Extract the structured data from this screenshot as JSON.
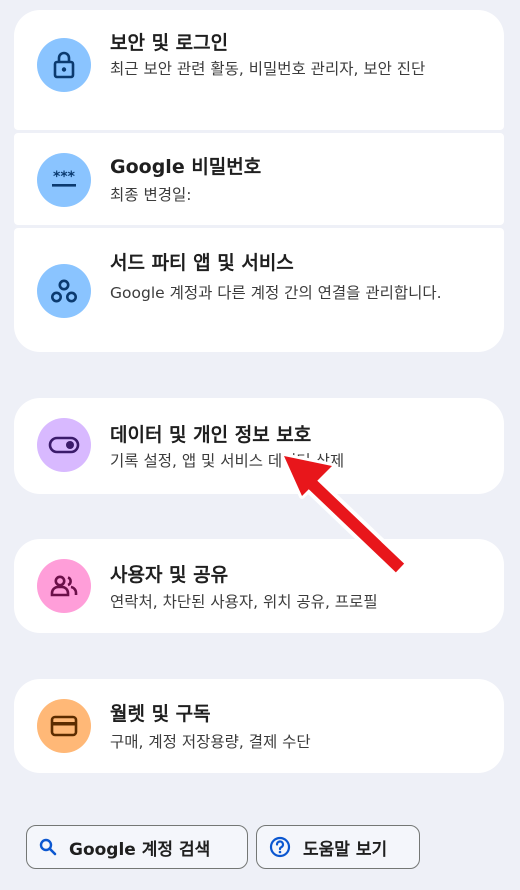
{
  "items": [
    {
      "title": "보안 및 로그인",
      "desc": "최근 보안 관련 활동, 비밀번호 관리자, 보안 진단",
      "icon": "lock-icon"
    },
    {
      "title": "Google 비밀번호",
      "desc": "최종 변경일:",
      "icon": "password-icon"
    },
    {
      "title": "서드 파티 앱 및 서비스",
      "desc": "Google 계정과 다른 계정 간의 연결을 관리합니다.",
      "icon": "connected-apps-icon"
    },
    {
      "title": "데이터 및 개인 정보 보호",
      "desc": "기록 설정, 앱 및 서비스 데이터 삭제",
      "icon": "toggle-icon"
    },
    {
      "title": "사용자 및 공유",
      "desc": "연락처, 차단된 사용자, 위치 공유, 프로필",
      "icon": "people-icon"
    },
    {
      "title": "월렛 및 구독",
      "desc": "구매, 계정 저장용량, 결제 수단",
      "icon": "wallet-icon"
    }
  ],
  "footer": {
    "search_label": "Google 계정 검색",
    "help_label": "도움말 보기"
  },
  "colors": {
    "background": "#eef0f7",
    "icon_blue": "#8ac4ff",
    "icon_purple": "#d8b9ff",
    "icon_pink": "#ff9ed9",
    "icon_orange": "#ffb877",
    "annotation_arrow": "#e8161b"
  }
}
